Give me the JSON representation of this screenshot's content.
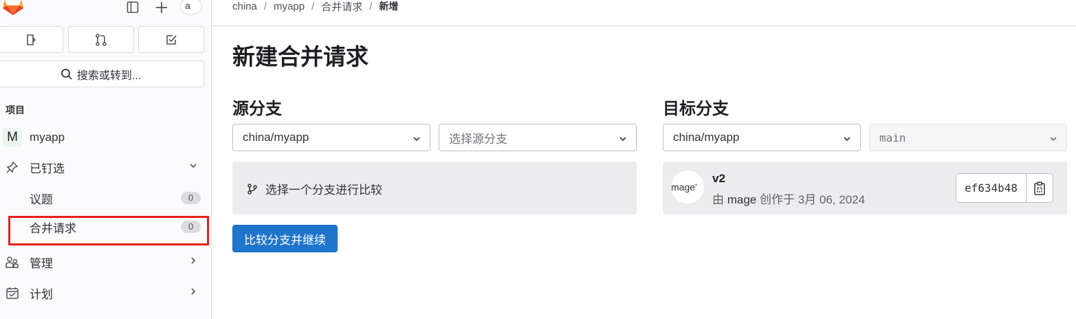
{
  "sidebar": {
    "avatar_alt": "a",
    "search_label": "搜索或转到...",
    "section_label": "项目",
    "project": {
      "initial": "M",
      "name": "myapp"
    },
    "pinned": {
      "label": "已钉选"
    },
    "pinned_items": [
      {
        "label": "议题",
        "count": "0"
      },
      {
        "label": "合并请求",
        "count": "0"
      }
    ],
    "items": [
      {
        "label": "管理"
      },
      {
        "label": "计划"
      }
    ]
  },
  "breadcrumb": {
    "items": [
      "china",
      "myapp",
      "合并请求"
    ],
    "current": "新增"
  },
  "page": {
    "title": "新建合并请求",
    "source": {
      "heading": "源分支",
      "project_value": "china/myapp",
      "branch_placeholder": "选择源分支",
      "compare_message": "选择一个分支进行比较"
    },
    "target": {
      "heading": "目标分支",
      "project_value": "china/myapp",
      "branch_value": "main",
      "commit": {
        "avatar_alt": "mage'",
        "title": "v2",
        "by": "由",
        "author": "mage",
        "created": "创作于 3月 06, 2024",
        "sha": "ef634b48"
      }
    },
    "compare_button": "比较分支并继续"
  },
  "colors": {
    "primary": "#1f75cb",
    "highlight": "#e5201b",
    "logo": "#e24329"
  }
}
